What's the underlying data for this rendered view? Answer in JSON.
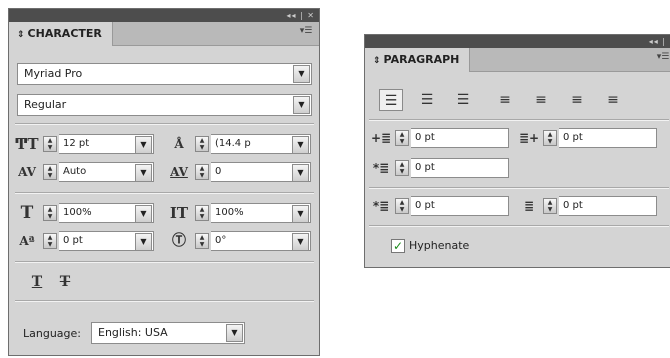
{
  "character": {
    "window_controls": "◂◂ | ✕",
    "tab_label": "CHARACTER",
    "font_family": "Myriad Pro",
    "font_style": "Regular",
    "font_size": "12 pt",
    "leading": "(14.4 p",
    "kerning": "Auto",
    "tracking": "0",
    "vertical_scale": "100%",
    "horizontal_scale": "100%",
    "baseline_shift": "0 pt",
    "rotation": "0°",
    "language_label": "Language:",
    "language_value": "English: USA"
  },
  "paragraph": {
    "window_controls": "◂◂ |",
    "tab_label": "PARAGRAPH",
    "left_indent": "0 pt",
    "right_indent": "0 pt",
    "first_line_indent": "0 pt",
    "space_before": "0 pt",
    "space_after": "0 pt",
    "hyphenate_label": "Hyphenate",
    "hyphenate_checked": true
  }
}
